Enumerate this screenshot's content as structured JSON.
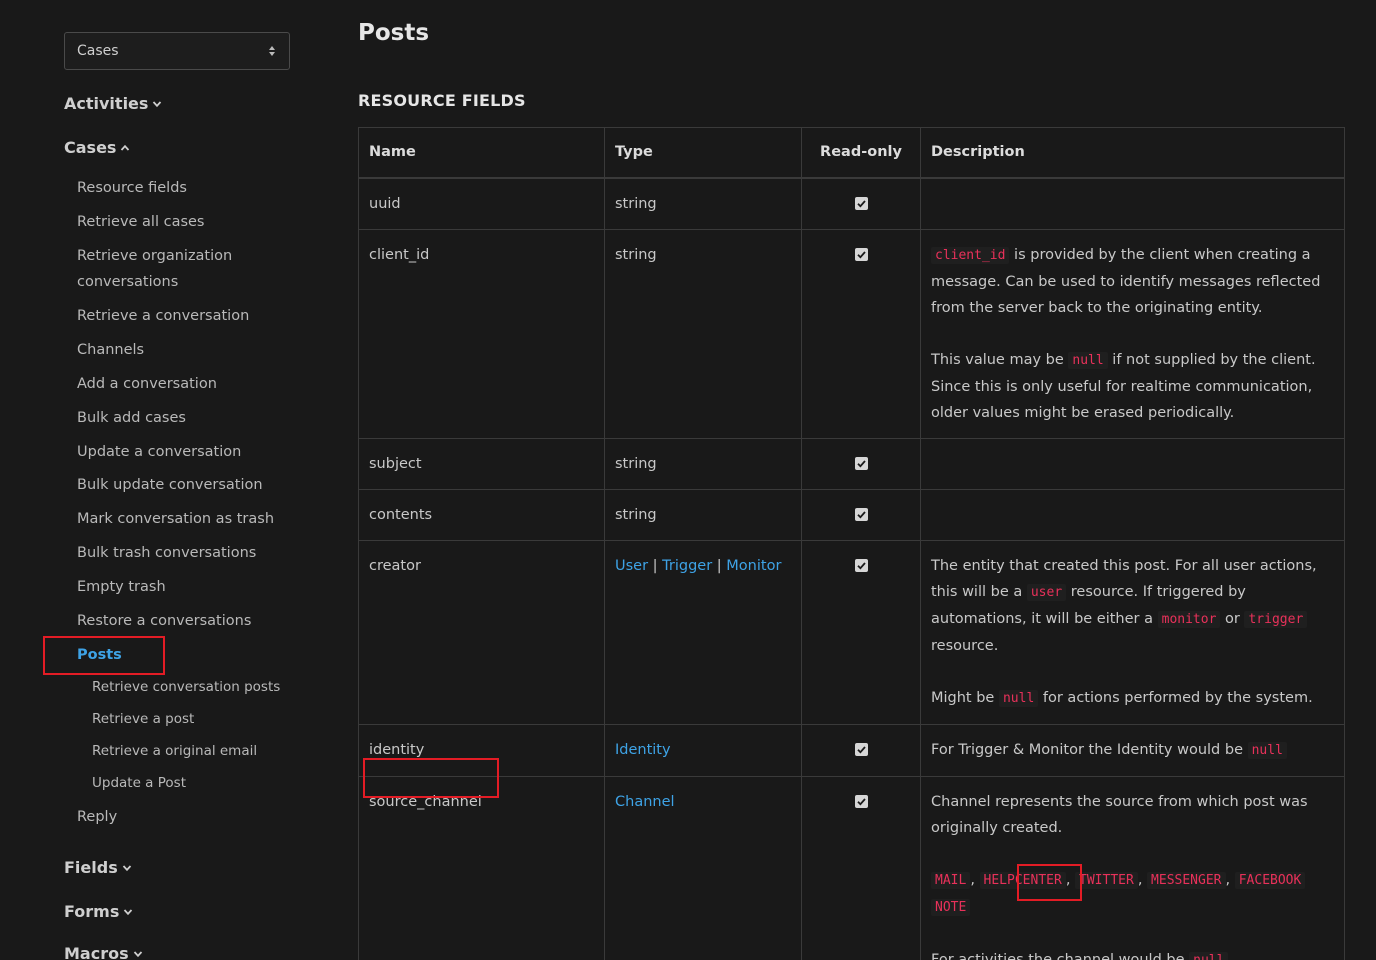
{
  "sidebar": {
    "select_value": "Cases",
    "groups": {
      "activities": "Activities",
      "cases": "Cases",
      "fields": "Fields",
      "forms": "Forms",
      "macros": "Macros"
    },
    "cases_items": [
      "Resource fields",
      "Retrieve all cases",
      "Retrieve organization conversations",
      "Retrieve a conversation",
      "Channels",
      "Add a conversation",
      "Bulk add cases",
      "Update a conversation",
      "Bulk update conversation",
      "Mark conversation as trash",
      "Bulk trash conversations",
      "Empty trash",
      "Restore a conversations",
      "Posts",
      "Reply"
    ],
    "posts_subitems": [
      "Retrieve conversation posts",
      "Retrieve a post",
      "Retrieve a original email",
      "Update a Post"
    ]
  },
  "main": {
    "title": "Posts",
    "section_title": "RESOURCE FIELDS",
    "table": {
      "headers": [
        "Name",
        "Type",
        "Read-only",
        "Description"
      ],
      "rows": {
        "uuid": {
          "name": "uuid",
          "type": "string"
        },
        "client_id": {
          "name": "client_id",
          "type": "string",
          "d1_code": "client_id",
          "d1_text": " is provided by the client when creating a message. Can be used to identify messages reflected from the server back to the originating entity.",
          "d2_pre": "This value may be ",
          "d2_code": "null",
          "d2_post": " if not supplied by the client. Since this is only useful for realtime communication, older values might be erased periodically."
        },
        "subject": {
          "name": "subject",
          "type": "string"
        },
        "contents": {
          "name": "contents",
          "type": "string"
        },
        "creator": {
          "name": "creator",
          "type_links": [
            "User",
            "Trigger",
            "Monitor"
          ],
          "type_sep": "|",
          "d1_a": "The entity that created this post. For all user actions, this will be a ",
          "d1_code1": "user",
          "d1_b": " resource. If triggered by automations, it will be either a ",
          "d1_code2": "monitor",
          "d1_c": " or ",
          "d1_code3": "trigger",
          "d1_d": " resource.",
          "d2_pre": "Might be ",
          "d2_code": "null",
          "d2_post": " for actions performed by the system."
        },
        "identity": {
          "name": "identity",
          "type": "Identity",
          "d_pre": "For Trigger & Monitor the Identity would be ",
          "d_code": "null"
        },
        "source_channel": {
          "name": "source_channel",
          "type": "Channel",
          "d1": "Channel represents the source from which post was originally created.",
          "codes": [
            "MAIL",
            "HELPCENTER",
            "TWITTER",
            "MESSENGER",
            "FACEBOOK",
            "NOTE"
          ],
          "code_sep": ",",
          "d3_pre": "For activities the channel would be ",
          "d3_code": "null"
        }
      }
    }
  }
}
